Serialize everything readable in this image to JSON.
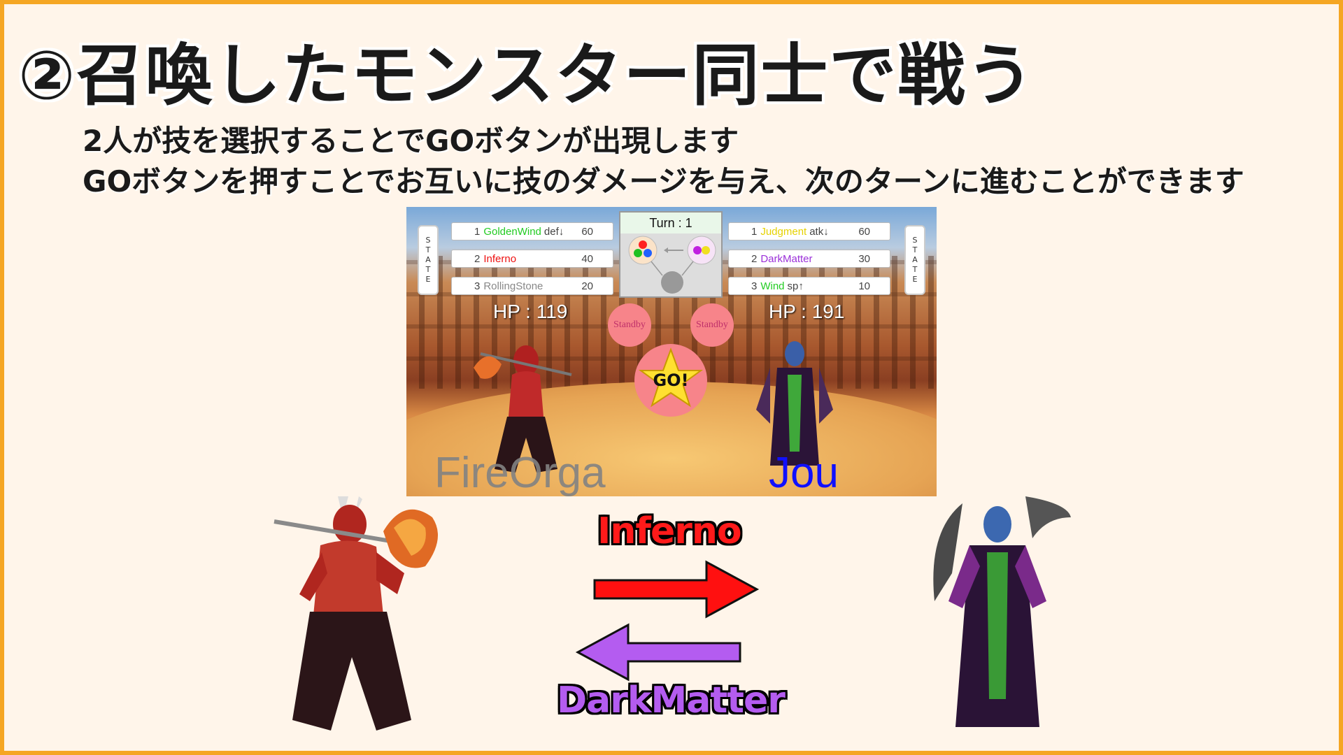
{
  "slide": {
    "title": "②召喚したモンスター同士で戦う",
    "description_line1": "2人が技を選択することでGOボタンが出現します",
    "description_line2": "GOボタンを押すことでお互いに技のダメージを与え、次のターンに進むことができます"
  },
  "game": {
    "turn_label": "Turn : 1",
    "state_letters": [
      "S",
      "T",
      "A",
      "T",
      "E"
    ],
    "player1": {
      "moves": [
        {
          "num": "1",
          "name": "GoldenWind",
          "suffix": "def↓",
          "power": "60",
          "color": "#22cc22"
        },
        {
          "num": "2",
          "name": "Inferno",
          "suffix": "",
          "power": "40",
          "color": "#ee1111"
        },
        {
          "num": "3",
          "name": "RollingStone",
          "suffix": "",
          "power": "20",
          "color": "#888888"
        }
      ],
      "hp": "HP : 119",
      "standby": "Standby",
      "name": "FireOrga"
    },
    "player2": {
      "moves": [
        {
          "num": "1",
          "name": "Judgment",
          "suffix": "atk↓",
          "power": "60",
          "color": "#e6d200"
        },
        {
          "num": "2",
          "name": "DarkMatter",
          "suffix": "",
          "power": "30",
          "color": "#9b30d9"
        },
        {
          "num": "3",
          "name": "Wind",
          "suffix": "sp↑",
          "power": "10",
          "color": "#22cc22"
        }
      ],
      "hp": "HP : 191",
      "standby": "Standby",
      "name": "Jou"
    },
    "go_label": "GO!"
  },
  "attacks": {
    "forward_label": "Inferno",
    "forward_color": "#ff1a1a",
    "backward_label": "DarkMatter",
    "backward_color": "#b45cf0"
  }
}
